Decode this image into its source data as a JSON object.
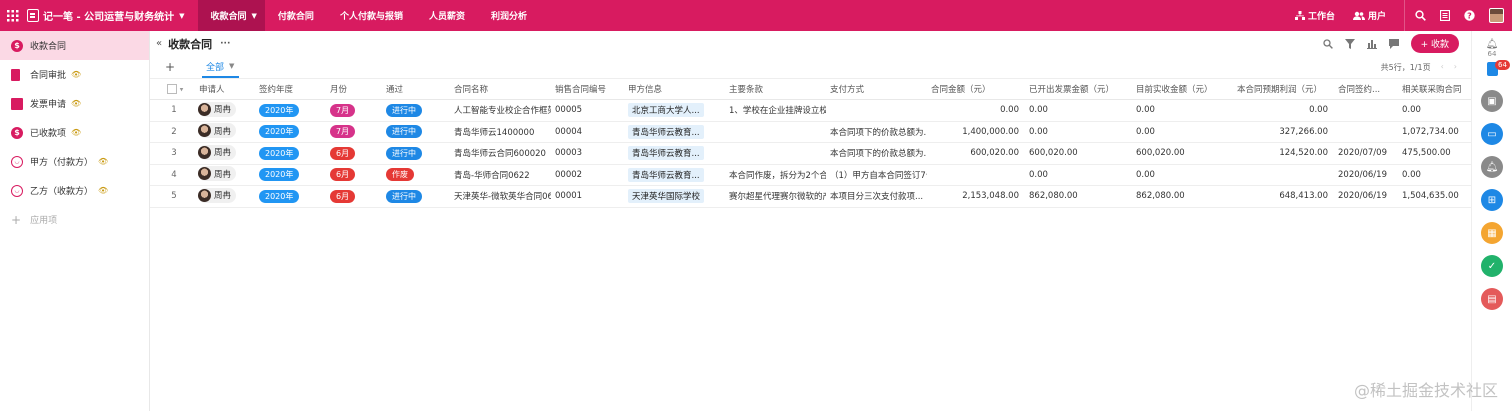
{
  "topbar": {
    "app_title": "记一笔 - 公司运营与财务统计",
    "nav": [
      "收款合同",
      "付款合同",
      "个人付款与报销",
      "人员薪资",
      "利润分析"
    ],
    "workbench": "工作台",
    "users": "用户"
  },
  "sidebar": {
    "items": [
      {
        "label": "收款合同",
        "icon": "dollar-icon"
      },
      {
        "label": "合同审批",
        "icon": "document-icon"
      },
      {
        "label": "发票申请",
        "icon": "invoice-icon"
      },
      {
        "label": "已收款项",
        "icon": "dollar-icon"
      },
      {
        "label": "甲方（付款方）",
        "icon": "smile-icon"
      },
      {
        "label": "乙方（收款方）",
        "icon": "smile-icon"
      }
    ],
    "add_label": "应用项"
  },
  "page": {
    "title": "收款合同",
    "add_button": "+ 收款",
    "tab_all": "全部",
    "pager_text": "共5行，1/1页"
  },
  "table": {
    "columns": [
      "申请人",
      "签约年度",
      "月份",
      "通过",
      "合同名称",
      "销售合同编号",
      "甲方信息",
      "主要条款",
      "支付方式",
      "合同金额（元）",
      "已开出发票金额（元）",
      "目前实收金额（元）",
      "本合同预期利润（元）",
      "合同签约...",
      "相关联采购合同"
    ],
    "rows": [
      {
        "idx": "1",
        "user": "周冉",
        "year": "2020年",
        "month": "7月",
        "month_color": "#d6338a",
        "status": "进行中",
        "status_color": "#1e88e5",
        "name": "人工智能专业校企合作框架",
        "code": "00005",
        "party": "北京工商大学人...",
        "terms": "1、学校在企业挂牌设立校",
        "pay": "",
        "amount": "0.00",
        "invoiced": "0.00",
        "received": "0.00",
        "profit": "0.00",
        "date": "",
        "purchase": "0.00"
      },
      {
        "idx": "2",
        "user": "周冉",
        "year": "2020年",
        "month": "7月",
        "month_color": "#d6338a",
        "status": "进行中",
        "status_color": "#1e88e5",
        "name": "青岛华师云1400000",
        "code": "00004",
        "party": "青岛华师云教育...",
        "terms": "",
        "pay": "本合同项下的价款总额为...",
        "amount": "1,400,000.00",
        "invoiced": "0.00",
        "received": "0.00",
        "profit": "327,266.00",
        "date": "",
        "purchase": "1,072,734.00"
      },
      {
        "idx": "3",
        "user": "周冉",
        "year": "2020年",
        "month": "6月",
        "month_color": "#e53935",
        "status": "进行中",
        "status_color": "#1e88e5",
        "name": "青岛华师云合同600020",
        "code": "00003",
        "party": "青岛华师云教育...",
        "terms": "",
        "pay": "本合同项下的价款总额为...",
        "amount": "600,020.00",
        "invoiced": "600,020.00",
        "received": "600,020.00",
        "profit": "124,520.00",
        "date": "2020/07/09",
        "purchase": "475,500.00"
      },
      {
        "idx": "4",
        "user": "周冉",
        "year": "2020年",
        "month": "6月",
        "month_color": "#e53935",
        "status": "作废",
        "status_color": "#e53935",
        "name": "青岛-华师合同0622",
        "code": "00002",
        "party": "青岛华师云教育...",
        "terms": "本合同作废，拆分为2个合",
        "pay": "（1）甲方自本合同签订7个",
        "amount": "",
        "invoiced": "0.00",
        "received": "0.00",
        "profit": "",
        "date": "2020/06/19",
        "purchase": "0.00"
      },
      {
        "idx": "5",
        "user": "周冉",
        "year": "2020年",
        "month": "6月",
        "month_color": "#e53935",
        "status": "进行中",
        "status_color": "#1e88e5",
        "name": "天津英华-微软英华合同06",
        "code": "00001",
        "party": "天津英华国际学校",
        "terms": "赛尔超星代理赛尔微软的产",
        "pay": "本项目分三次支付款项...",
        "amount": "2,153,048.00",
        "invoiced": "862,080.00",
        "received": "862,080.00",
        "profit": "648,413.00",
        "date": "2020/06/19",
        "purchase": "1,504,635.00"
      }
    ]
  },
  "rail": {
    "notification_count": "64",
    "badge": "64"
  },
  "watermark": "@稀土掘金技术社区"
}
